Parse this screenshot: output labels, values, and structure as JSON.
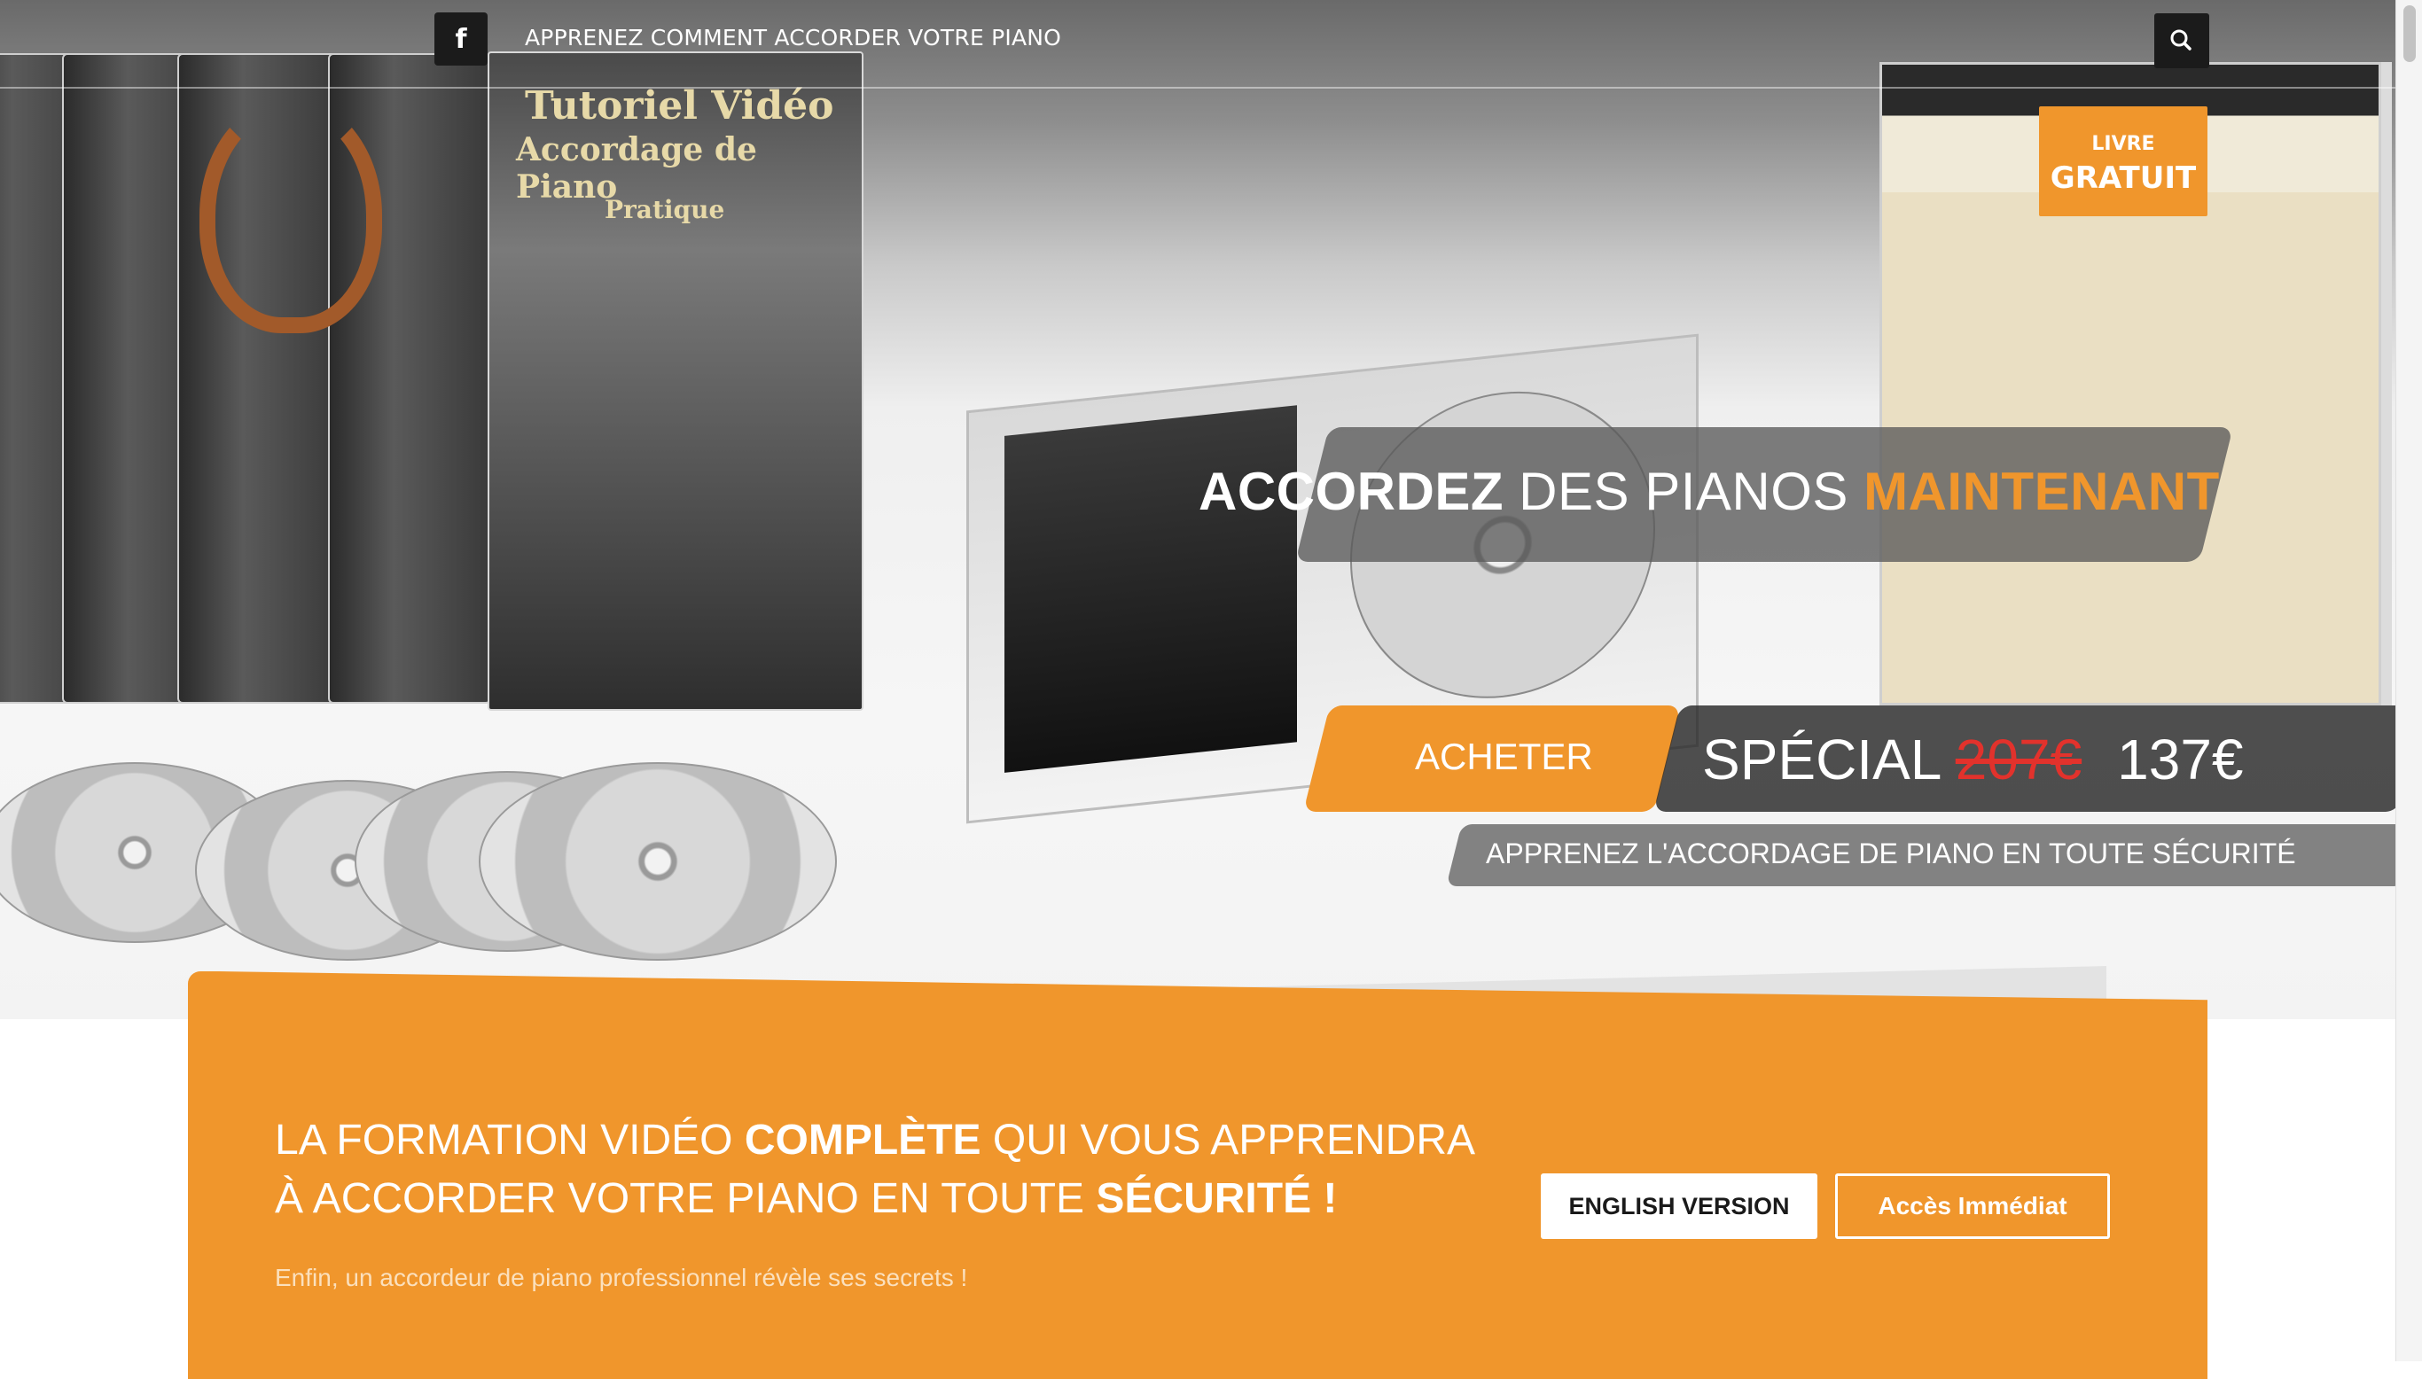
{
  "topbar": {
    "title": "APPRENEZ COMMENT ACCORDER VOTRE PIANO",
    "facebook_icon": "facebook-icon",
    "search_icon": "search-icon"
  },
  "art": {
    "dvd_title_1": "Tutoriel Vidéo",
    "dvd_title_2": "Accordage de Piano",
    "dvd_title_3": "Pratique"
  },
  "badge": {
    "line1": "LIVRE",
    "line2": "GRATUIT"
  },
  "hero": {
    "headline_bold": "ACCORDEZ",
    "headline_mid": " DES PIANOS ",
    "headline_accent": "MAINTENANT",
    "buy_label": "ACHETER",
    "price_label": "SPÉCIAL ",
    "price_old": "207€",
    "price_new": "137€",
    "subline": "APPRENEZ L'ACCORDAGE DE PIANO EN TOUTE SÉCURITÉ"
  },
  "promo": {
    "title_part1": "LA FORMATION VIDÉO ",
    "title_bold1": "COMPLÈTE",
    "title_part2": " QUI VOUS APPRENDRA À ACCORDER VOTRE PIANO EN TOUTE ",
    "title_bold2": "SÉCURITÉ !",
    "subtitle": "Enfin, un accordeur de piano professionnel révèle ses secrets !",
    "english_button": "ENGLISH VERSION",
    "access_button": "Accès Immédiat"
  },
  "colors": {
    "accent": "#f0962c",
    "dark": "#1b1b1b",
    "price_old": "#e2322c"
  }
}
